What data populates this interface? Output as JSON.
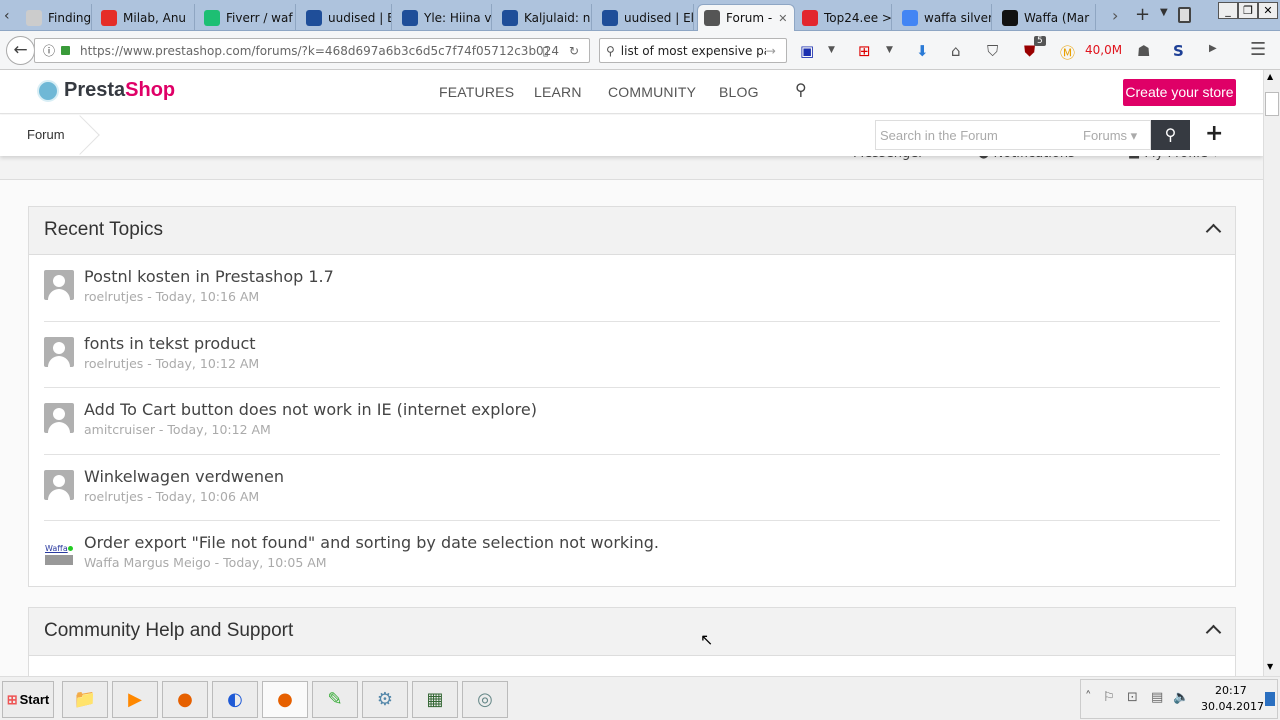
{
  "browser": {
    "tabs": [
      {
        "label": "Finding Co",
        "icon": "generic-icon",
        "color": "#cccccc"
      },
      {
        "label": "Milab, Anu",
        "icon": "youtube-icon",
        "color": "#e52d27"
      },
      {
        "label": "Fiverr / waf",
        "icon": "fiverr-icon",
        "color": "#1dbf73"
      },
      {
        "label": "uudised | El",
        "icon": "err-icon",
        "color": "#1f4e99"
      },
      {
        "label": "Yle: Hiina v",
        "icon": "err-icon",
        "color": "#1f4e99"
      },
      {
        "label": "Kaljulaid: n",
        "icon": "err-icon",
        "color": "#1f4e99"
      },
      {
        "label": "uudised | El",
        "icon": "err-icon",
        "color": "#1f4e99"
      },
      {
        "label": "Forum -",
        "icon": "prestashop-icon",
        "color": "#555555",
        "active": true
      },
      {
        "label": "Top24.ee >",
        "icon": "cart-icon",
        "color": "#e3262e"
      },
      {
        "label": "waffa silver",
        "icon": "google-icon",
        "color": "#4285f4"
      },
      {
        "label": "Waffa (Mar",
        "icon": "github-icon",
        "color": "#111111"
      }
    ],
    "url": "https://www.prestashop.com/forums/?k=468d697a6b3c6d5c7f74f05712c3b024",
    "url_domain": "prestashop.com",
    "search_value": "list of most expensive paint",
    "badge_count": "5",
    "counter_value": "40,0M"
  },
  "site": {
    "logo_text_a": "Presta",
    "logo_text_b": "Shop",
    "menu": [
      "FEATURES",
      "LEARN",
      "COMMUNITY",
      "BLOG"
    ],
    "cta": "Create your store",
    "accent": "#df0067",
    "breadcrumb": "Forum",
    "search_placeholder": "Search in the Forum",
    "search_scope": "Forums",
    "substrip": [
      "Messenger",
      "Notifications",
      "My Profile"
    ]
  },
  "recent": {
    "title": "Recent Topics",
    "topics": [
      {
        "title": "Postnl kosten in Prestashop 1.7",
        "meta": "roelrutjes - Today, 10:16 AM"
      },
      {
        "title": "fonts in tekst product",
        "meta": "roelrutjes - Today, 10:12 AM"
      },
      {
        "title": "Add To Cart button does not work in IE (internet explore)",
        "meta": "amitcruiser - Today, 10:12 AM"
      },
      {
        "title": "Winkelwagen verdwenen",
        "meta": "roelrutjes - Today, 10:06 AM"
      },
      {
        "title": "Order export \"File not found\" and sorting by date selection not working.",
        "meta": "Waffa Margus Meigo - Today, 10:05 AM",
        "avatar": "Waffa"
      }
    ]
  },
  "community": {
    "title": "Community Help and Support"
  },
  "taskbar": {
    "start": "Start",
    "time": "20:17",
    "date": "30.04.2017"
  }
}
